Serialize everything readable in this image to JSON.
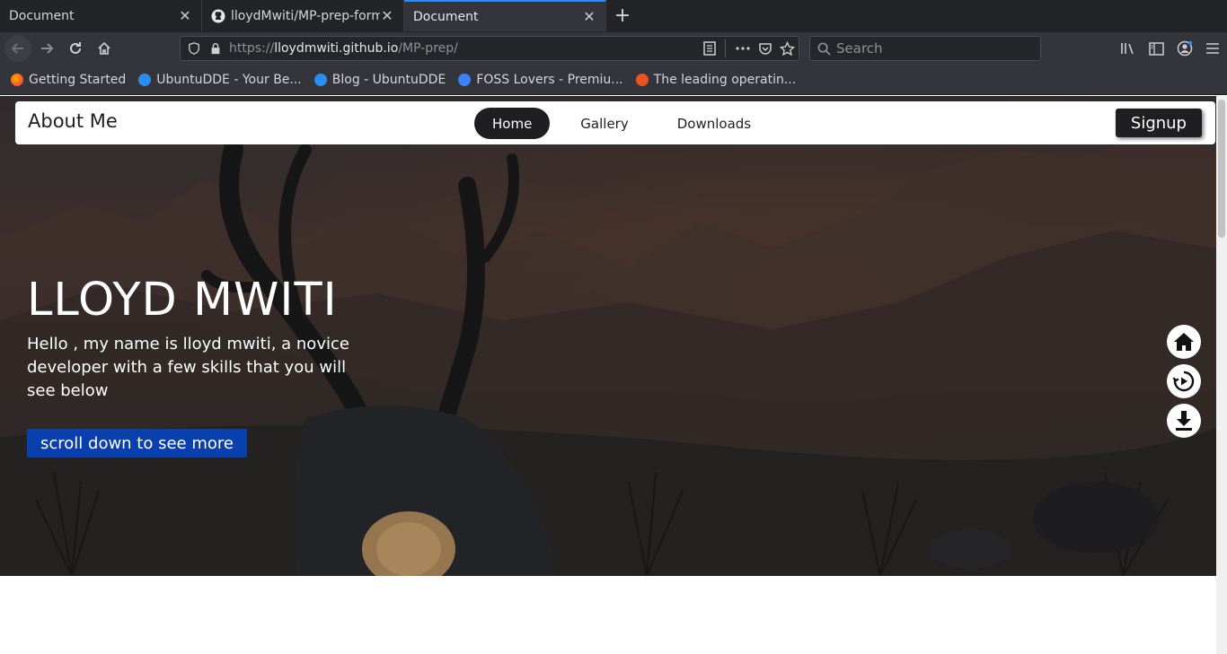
{
  "browser": {
    "tabs": [
      {
        "title": "Document",
        "active": false
      },
      {
        "title": "lloydMwiti/MP-prep-form",
        "active": false
      },
      {
        "title": "Document",
        "active": true
      }
    ],
    "url": {
      "prefix": "https://",
      "host": "lloydmwiti.github.io",
      "path": "/MP-prep/"
    },
    "search_placeholder": "Search",
    "bookmarks": [
      {
        "label": "Getting Started",
        "color": "#ff6d1f"
      },
      {
        "label": "UbuntuDDE - Your Be...",
        "color": "#2d8cf0"
      },
      {
        "label": "Blog - UbuntuDDE",
        "color": "#2d8cf0"
      },
      {
        "label": "FOSS Lovers - Premiu...",
        "color": "#3b82f6"
      },
      {
        "label": "The leading operatin...",
        "color": "#e95420"
      }
    ]
  },
  "site": {
    "brand": "About Me",
    "menu": [
      {
        "label": "Home",
        "active": true
      },
      {
        "label": "Gallery",
        "active": false
      },
      {
        "label": "Downloads",
        "active": false
      }
    ],
    "signup_label": "Signup",
    "hero": {
      "title": "LLOYD MWITI",
      "text": "Hello , my name is lloyd mwiti, a novice developer with a few skills that you will see below",
      "cta_label": "scroll down to see more"
    },
    "side_icons": [
      "home-icon",
      "replay-icon",
      "download-icon"
    ]
  }
}
